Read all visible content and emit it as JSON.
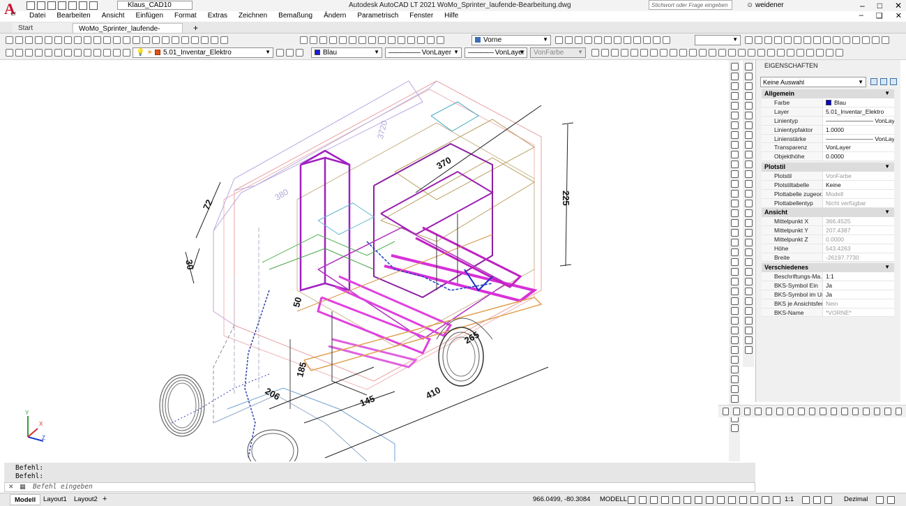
{
  "app": {
    "title": "Autodesk AutoCAD LT 2021   WoMo_Sprinter_laufende-Bearbeitung.dwg",
    "logo_letter": "A",
    "logo_sub": "LT",
    "workspace": "Klaus_CAD10",
    "search_placeholder": "Stichwort oder Frage eingeben",
    "user": "weidener"
  },
  "menu": [
    "Datei",
    "Bearbeiten",
    "Ansicht",
    "Einfügen",
    "Format",
    "Extras",
    "Zeichnen",
    "Bemaßung",
    "Ändern",
    "Parametrisch",
    "Fenster",
    "Hilfe"
  ],
  "tabs": {
    "start": "Start",
    "document": "WoMo_Sprinter_laufende-Bearbeitung*",
    "add": "+"
  },
  "toolbar": {
    "view": "Vorne",
    "layer": "5.01_Inventar_Elektro",
    "color": "Blau",
    "linetype": "VonLayer",
    "lineweight": "VonLayer",
    "plotstyle": "VonFarbe",
    "color_hex": "#1a1ad8",
    "layer_color_hex": "#e0501a"
  },
  "properties": {
    "title": "EIGENSCHAFTEN",
    "selection": "Keine Auswahl",
    "sections": [
      {
        "name": "Allgemein",
        "rows": [
          {
            "k": "Farbe",
            "v": "Blau",
            "swatch": "#0000cc"
          },
          {
            "k": "Layer",
            "v": "5.01_Inventar_Elektro"
          },
          {
            "k": "Linientyp",
            "v": "———————— VonLayer"
          },
          {
            "k": "Linientypfaktor",
            "v": "1.0000"
          },
          {
            "k": "Linienstärke",
            "v": "———————— VonLayer"
          },
          {
            "k": "Transparenz",
            "v": "VonLayer"
          },
          {
            "k": "Objekthöhe",
            "v": "0.0000"
          }
        ]
      },
      {
        "name": "Plotstil",
        "rows": [
          {
            "k": "Plotstil",
            "v": "VonFarbe",
            "dim": true
          },
          {
            "k": "Plotstiltabelle",
            "v": "Keine"
          },
          {
            "k": "Plottabelle zugeor...",
            "v": "Modell",
            "dim": true
          },
          {
            "k": "Plottabellentyp",
            "v": "Nicht verfügbar",
            "dim": true
          }
        ]
      },
      {
        "name": "Ansicht",
        "rows": [
          {
            "k": "Mittelpunkt X",
            "v": "366.4525",
            "dim": true
          },
          {
            "k": "Mittelpunkt Y",
            "v": "207.4387",
            "dim": true
          },
          {
            "k": "Mittelpunkt Z",
            "v": "0.0000",
            "dim": true
          },
          {
            "k": "Höhe",
            "v": "543.4263",
            "dim": true
          },
          {
            "k": "Breite",
            "v": "-26197.7730",
            "dim": true
          }
        ]
      },
      {
        "name": "Verschiedenes",
        "rows": [
          {
            "k": "Beschriftungs-Ma...",
            "v": "1:1"
          },
          {
            "k": "BKS-Symbol Ein",
            "v": "Ja"
          },
          {
            "k": "BKS-Symbol im Ur...",
            "v": "Ja"
          },
          {
            "k": "BKS je Ansichtsfen...",
            "v": "Nein",
            "dim": true
          },
          {
            "k": "BKS-Name",
            "v": "*VORNE*",
            "dim": true
          }
        ]
      }
    ]
  },
  "drawing": {
    "dims": [
      "3720",
      "370",
      "225",
      "72",
      "30",
      "380",
      "265",
      "410",
      "145",
      "206",
      "185",
      "50"
    ]
  },
  "command": {
    "history": [
      "Befehl:",
      "Befehl:"
    ],
    "placeholder": "Befehl eingeben"
  },
  "status": {
    "layouts": [
      "Modell",
      "Layout1",
      "Layout2"
    ],
    "add": "+",
    "coords": "966.0499, -80.3084",
    "mode": "MODELL",
    "scale": "1:1",
    "units": "Dezimal"
  }
}
